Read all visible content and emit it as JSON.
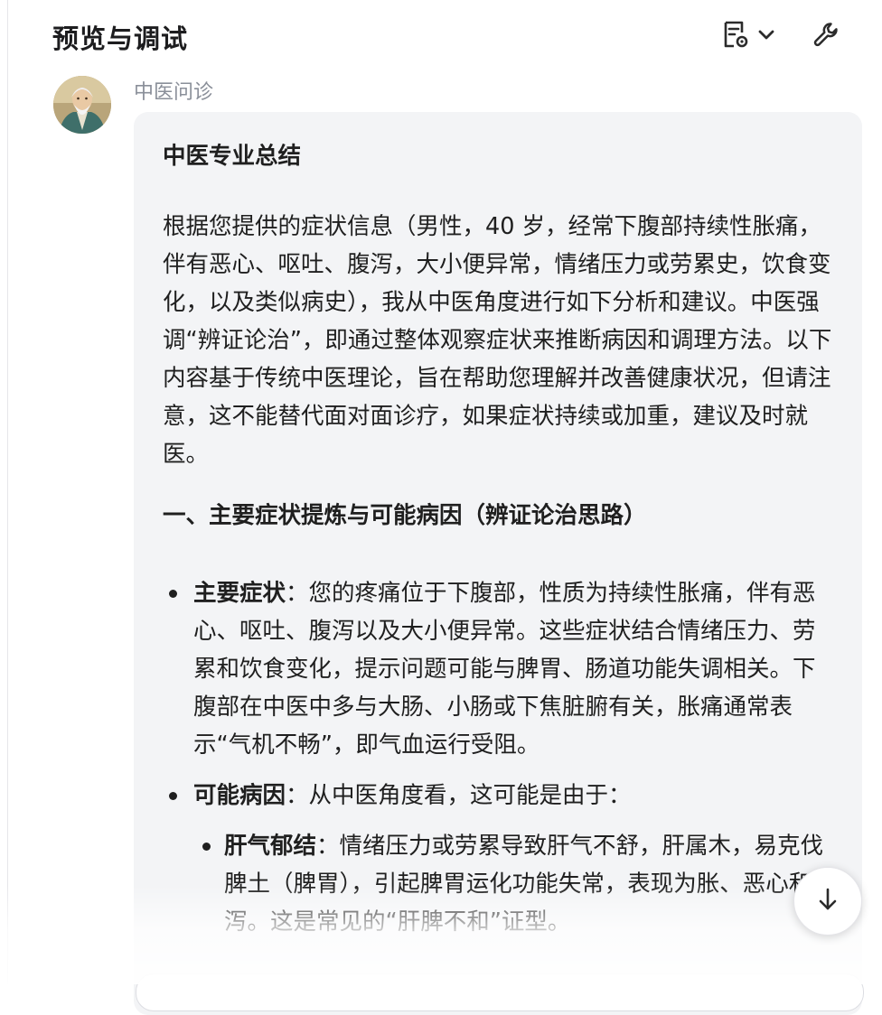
{
  "header": {
    "title": "预览与调试",
    "icons": {
      "preview": "document-settings-icon",
      "dropdown": "chevron-down-icon",
      "tool": "wrench-icon"
    }
  },
  "message": {
    "bot_name": "中医问诊",
    "summary_title": "中医专业总结",
    "intro": "根据您提供的症状信息（男性，40 岁，经常下腹部持续性胀痛，伴有恶心、呕吐、腹泻，大小便异常，情绪压力或劳累史，饮食变化，以及类似病史），我从中医角度进行如下分析和建议。中医强调“辨证论治”，即通过整体观察症状来推断病因和调理方法。以下内容基于传统中医理论，旨在帮助您理解并改善健康状况，但请注意，这不能替代面对面诊疗，如果症状持续或加重，建议及时就医。",
    "section1_title": "一、主要症状提炼与可能病因（辨证论治思路）",
    "bullets": [
      {
        "term": "主要症状",
        "text": "：您的疼痛位于下腹部，性质为持续性胀痛，伴有恶心、呕吐、腹泻以及大小便异常。这些症状结合情绪压力、劳累和饮食变化，提示问题可能与脾胃、肠道功能失调相关。下腹部在中医中多与大肠、小肠或下焦脏腑有关，胀痛通常表示“气机不畅”，即气血运行受阻。"
      },
      {
        "term": "可能病因",
        "text": "：从中医角度看，这可能是由于："
      }
    ],
    "sub_bullets": [
      {
        "term": "肝气郁结",
        "text": "：情绪压力或劳累导致肝气不舒，肝属木，易克伐脾土（脾胃），引起脾胃运化功能失常，表现为胀、恶心和腹泻。这是常见的“肝脾不和”证型。"
      }
    ]
  },
  "controls": {
    "scroll_icon": "arrow-down-icon"
  },
  "colors": {
    "bubble": "#f3f4f6",
    "muted": "#8a8f99",
    "text": "#1f1f1f"
  }
}
